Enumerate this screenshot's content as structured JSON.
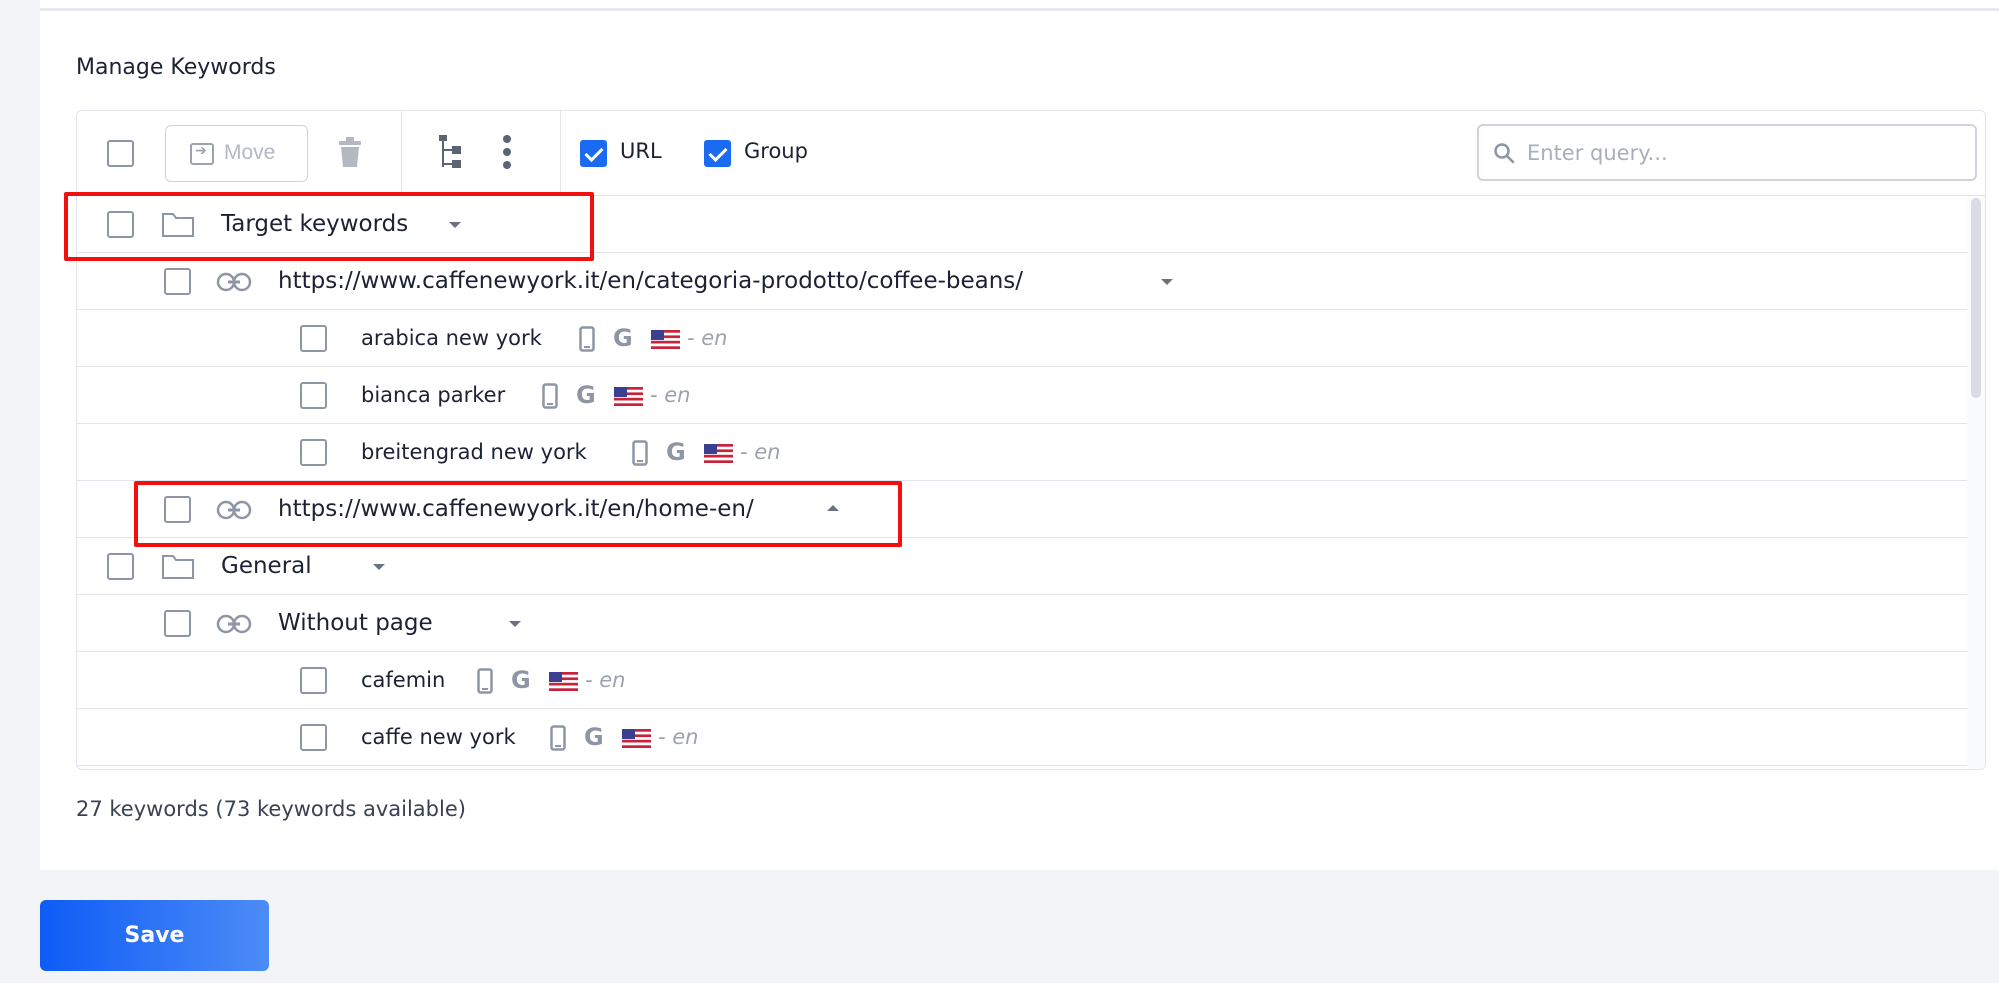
{
  "section_title": "Manage Keywords",
  "toolbar": {
    "move_label": "Move",
    "url_label": "URL",
    "url_checked": true,
    "group_label": "Group",
    "group_checked": true,
    "search_placeholder": "Enter query..."
  },
  "rows": [
    {
      "type": "group",
      "label": "Target keywords",
      "caret": "down"
    },
    {
      "type": "page",
      "label": "https://www.caffenewyork.it/en/categoria-prodotto/coffee-beans/",
      "caret": "down"
    },
    {
      "type": "keyword",
      "label": "arabica new york",
      "lang": "- en"
    },
    {
      "type": "keyword",
      "label": "bianca parker",
      "lang": "- en"
    },
    {
      "type": "keyword",
      "label": "breitengrad new york",
      "lang": "- en"
    },
    {
      "type": "page",
      "label": "https://www.caffenewyork.it/en/home-en/",
      "caret": "up"
    },
    {
      "type": "group",
      "label": "General",
      "caret": "down"
    },
    {
      "type": "page",
      "label": "Without page",
      "caret": "down"
    },
    {
      "type": "keyword",
      "label": "cafemin",
      "lang": "- en"
    },
    {
      "type": "keyword",
      "label": "caffe new york",
      "lang": "- en"
    }
  ],
  "footer": {
    "count_text": "27 keywords (73 keywords available)"
  },
  "save_label": "Save",
  "colors": {
    "accent": "#1b6bf2",
    "highlight": "#f20f0f"
  }
}
